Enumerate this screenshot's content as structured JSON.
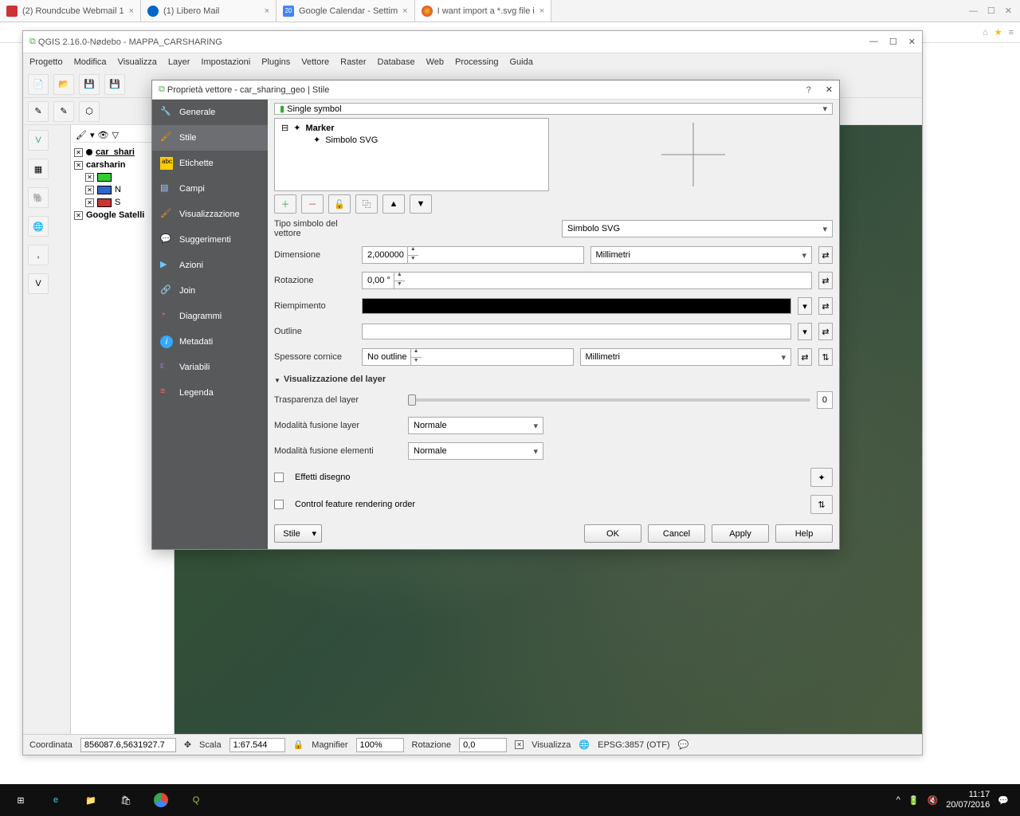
{
  "browser": {
    "tabs": [
      {
        "label": "(2) Roundcube Webmail 1"
      },
      {
        "label": "(1) Libero Mail"
      },
      {
        "label": "Google Calendar - Settim"
      },
      {
        "label": "I want import a *.svg file i"
      }
    ]
  },
  "qgis": {
    "title": "QGIS 2.16.0-Nødebo - MAPPA_CARSHARING",
    "menu": [
      "Progetto",
      "Modifica",
      "Visualizza",
      "Layer",
      "Impostazioni",
      "Plugins",
      "Vettore",
      "Raster",
      "Database",
      "Web",
      "Processing",
      "Guida"
    ],
    "layers": {
      "l1": "car_shari",
      "l2": "carsharin",
      "l3": "N",
      "l4": "S",
      "l5": "Google Satelli"
    },
    "status": {
      "coord_lbl": "Coordinata",
      "coord": "856087.6,5631927.7",
      "scale_lbl": "Scala",
      "scale": "1:67.544",
      "mag_lbl": "Magnifier",
      "mag": "100%",
      "rot_lbl": "Rotazione",
      "rot": "0,0",
      "vis": "Visualizza",
      "crs": "EPSG:3857 (OTF)"
    }
  },
  "dialog": {
    "title": "Proprietà vettore - car_sharing_geo | Stile",
    "sidebar": [
      "Generale",
      "Stile",
      "Etichette",
      "Campi",
      "Visualizzazione",
      "Suggerimenti",
      "Azioni",
      "Join",
      "Diagrammi",
      "Metadati",
      "Variabili",
      "Legenda"
    ],
    "symtype": "Single symbol",
    "tree": {
      "marker": "Marker",
      "svg": "Simbolo SVG"
    },
    "fields": {
      "type_lbl": "Tipo simbolo del vettore",
      "type_val": "Simbolo SVG",
      "dim_lbl": "Dimensione",
      "dim_val": "2,000000",
      "dim_unit": "Millimetri",
      "rot_lbl": "Rotazione",
      "rot_val": "0,00 °",
      "fill_lbl": "Riempimento",
      "out_lbl": "Outline",
      "thick_lbl": "Spessore cornice",
      "thick_val": "No outline",
      "thick_unit": "Millimetri"
    },
    "viz": {
      "header": "Visualizzazione del layer",
      "trans_lbl": "Trasparenza del layer",
      "trans_val": "0",
      "blend1_lbl": "Modalità fusione layer",
      "blend1_val": "Normale",
      "blend2_lbl": "Modalità fusione elementi",
      "blend2_val": "Normale",
      "fx": "Effetti disegno",
      "order": "Control feature rendering order"
    },
    "buttons": {
      "style": "Stile",
      "ok": "OK",
      "cancel": "Cancel",
      "apply": "Apply",
      "help": "Help"
    }
  },
  "taskbar": {
    "time": "11:17",
    "date": "20/07/2016"
  }
}
